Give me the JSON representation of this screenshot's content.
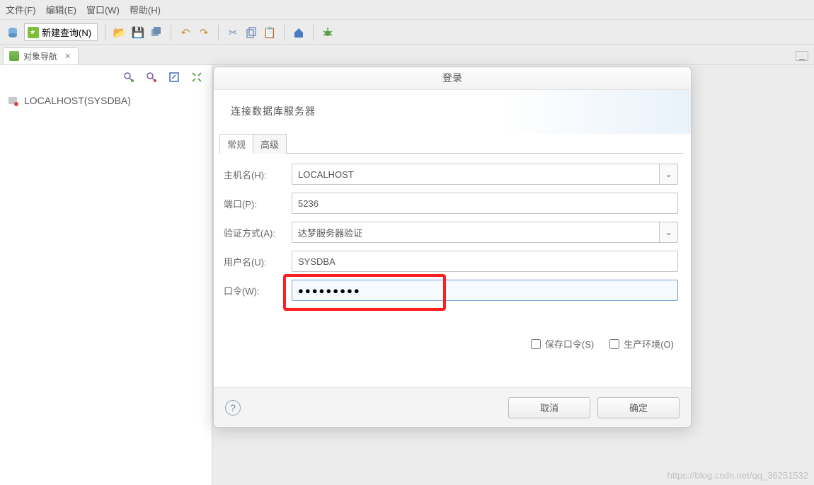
{
  "menu": {
    "file": "文件(F)",
    "edit": "编辑(E)",
    "window": "窗口(W)",
    "help": "帮助(H)"
  },
  "toolbar": {
    "new_query": "新建查询(N)"
  },
  "panel": {
    "tab_title": "对象导航",
    "tree_root": "LOCALHOST(SYSDBA)"
  },
  "dialog": {
    "title": "登录",
    "header": "连接数据库服务器",
    "tab_general": "常规",
    "tab_advanced": "高级",
    "labels": {
      "host": "主机名(H):",
      "port": "端口(P):",
      "auth": "验证方式(A):",
      "user": "用户名(U):",
      "password": "口令(W):"
    },
    "values": {
      "host": "LOCALHOST",
      "port": "5236",
      "auth": "达梦服务器验证",
      "user": "SYSDBA",
      "password": "●●●●●●●●●"
    },
    "check_save_pwd": "保存口令(S)",
    "check_prod_env": "生产环境(O)",
    "btn_cancel": "取消",
    "btn_ok": "确定"
  },
  "watermark": "https://blog.csdn.net/qq_36251532"
}
